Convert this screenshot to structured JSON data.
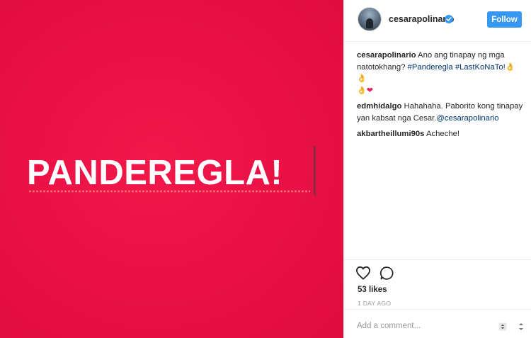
{
  "media": {
    "text": "PANDEREGLA!"
  },
  "header": {
    "username": "cesarapolinario",
    "follow_label": "Follow"
  },
  "comments": [
    {
      "user": "cesarapolinario",
      "text": " Ano ang tinapay ng mga natotokhang? ",
      "hashtag1": "#Panderegla",
      "hashtag2": "#LastKoNaTo!"
    },
    {
      "user": "edmhidalgo",
      "text": " Hahahaha. Paborito kong tinapay yan kabsat nga Cesar.",
      "mention": "@cesarapolinario"
    },
    {
      "user": "akbartheillumi90s",
      "text": " Acheche!"
    }
  ],
  "actions": {
    "likes": "53 likes",
    "timestamp": "1 DAY AGO"
  },
  "add_comment": {
    "placeholder": "Add a comment..."
  },
  "icons": {
    "verified": "verified-badge-icon",
    "like": "heart-outline-icon",
    "comment": "speech-bubble-icon",
    "options": "more-options-icon"
  },
  "colors": {
    "media_background": "#ea1145",
    "accent": "#3897f0",
    "hashtag": "#003569"
  }
}
